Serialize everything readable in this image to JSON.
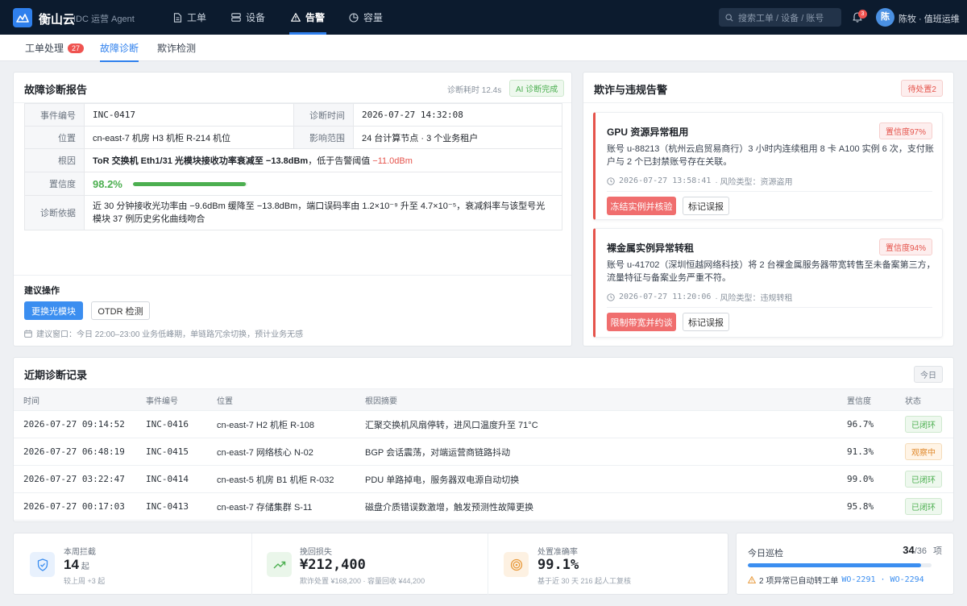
{
  "app": {
    "brand": "衡山云",
    "subtitle": "IDC 运营 Agent"
  },
  "nav": [
    {
      "label": "工单",
      "icon": "document-icon"
    },
    {
      "label": "设备",
      "icon": "server-icon"
    },
    {
      "label": "告警",
      "icon": "warning-icon",
      "active": true
    },
    {
      "label": "容量",
      "icon": "pie-chart-icon"
    }
  ],
  "header": {
    "search_placeholder": "搜索工单 / 设备 / 账号",
    "notifications": "3",
    "avatar_initial": "陈",
    "user": "陈牧 · 值班运维"
  },
  "subtabs": [
    {
      "label": "工单处理",
      "count": "27"
    },
    {
      "label": "故障诊断",
      "active": true
    },
    {
      "label": "欺诈检测"
    }
  ],
  "diagnosis": {
    "title": "故障诊断报告",
    "elapsed": "诊断耗时 12.4s",
    "status": "AI 诊断完成",
    "fields": {
      "incident_k": "事件编号",
      "incident_v": "INC-0417",
      "time_k": "诊断时间",
      "time_v": "2026-07-27 14:32:08",
      "location_k": "位置",
      "location_v": "cn-east-7 机房 H3 机柜 R-214 机位",
      "scope_k": "影响范围",
      "scope_v": "24 台计算节点 · 3 个业务租户",
      "cause_k": "根因",
      "cause_main": "ToR 交换机 Eth1/31 光模块接收功率衰减至 −13.8dBm",
      "cause_mid": "，低于告警阈值 ",
      "cause_threshold": "−11.0dBm",
      "confidence_k": "置信度",
      "confidence_v": "98.2%",
      "basis_k": "诊断依据",
      "basis_v": "近 30 分钟接收光功率由 −9.6dBm 缓降至 −13.8dBm，端口误码率由 1.2×10⁻⁹ 升至 4.7×10⁻⁵，衰减斜率与该型号光模块 37 例历史劣化曲线吻合"
    },
    "confidence": 0.982,
    "suggest_title": "建议操作",
    "btn_replace": "更换光模块",
    "btn_otdr": "OTDR 检测",
    "window_note": "建议窗口：今日 22:00–23:00 业务低峰期，单链路冗余切换，预计业务无感"
  },
  "fraud": {
    "title": "欺诈与违规告警",
    "pending": "待处置2",
    "cards": [
      {
        "title": "GPU 资源异常租用",
        "confidence": "置信度97%",
        "desc": "账号 u-88213（杭州云启贸易商行）3 小时内连续租用 8 卡 A100 实例 6 次，支付账户与 2 个已封禁账号存在关联。",
        "time": "2026-07-27 13:58:41",
        "risk": "· 风险类型：资源盗用",
        "action": "冻结实例并核验",
        "dismiss": "标记误报"
      },
      {
        "title": "裸金属实例异常转租",
        "confidence": "置信度94%",
        "desc": "账号 u-41702（深圳恒越网络科技）将 2 台裸金属服务器带宽转售至未备案第三方，流量特征与备案业务严重不符。",
        "time": "2026-07-27 11:20:06",
        "risk": "· 风险类型：违规转租",
        "action": "限制带宽并约谈",
        "dismiss": "标记误报"
      }
    ]
  },
  "history": {
    "title": "近期诊断记录",
    "filter": "今日",
    "columns": [
      "时间",
      "事件编号",
      "位置",
      "根因摘要",
      "置信度",
      "状态"
    ],
    "rows": [
      {
        "time": "2026-07-27 09:14:52",
        "id": "INC-0416",
        "location": "cn-east-7 H2 机柜 R-108",
        "summary": "汇聚交换机风扇停转，进风口温度升至 71°C",
        "conf": "96.7%",
        "status": "已闭环",
        "tone": "green"
      },
      {
        "time": "2026-07-27 06:48:19",
        "id": "INC-0415",
        "location": "cn-east-7 网络核心 N-02",
        "summary": "BGP 会话震荡，对端运营商链路抖动",
        "conf": "91.3%",
        "status": "观察中",
        "tone": "orange"
      },
      {
        "time": "2026-07-27 03:22:47",
        "id": "INC-0414",
        "location": "cn-east-5 机房 B1 机柜 R-032",
        "summary": "PDU 单路掉电，服务器双电源自动切换",
        "conf": "99.0%",
        "status": "已闭环",
        "tone": "green"
      },
      {
        "time": "2026-07-27 00:17:03",
        "id": "INC-0413",
        "location": "cn-east-7 存储集群 S-11",
        "summary": "磁盘介质错误数激增，触发预测性故障更换",
        "conf": "95.8%",
        "status": "已闭环",
        "tone": "green"
      }
    ]
  },
  "stats": [
    {
      "label": "本周拦截",
      "value": "14",
      "unit": "起",
      "sub": "较上周 +3 起",
      "icon": "shield-icon",
      "color": "#3b8ef0",
      "bg": "#e8f1fd"
    },
    {
      "label": "挽回损失",
      "value": "¥212,400",
      "unit": "",
      "sub": "欺诈处置 ¥168,200 · 容量回收 ¥44,200",
      "icon": "trend-up-icon",
      "color": "#4caf50",
      "bg": "#eaf6ea"
    },
    {
      "label": "处置准确率",
      "value": "99.1%",
      "unit": "",
      "sub": "基于近 30 天 216 起人工复核",
      "icon": "target-icon",
      "color": "#e89a3c",
      "bg": "#fdf1e2"
    }
  ],
  "patrol": {
    "label": "今日巡检",
    "done": "34",
    "total": "/36",
    "unit": "项",
    "progress": 0.944,
    "note": "2 项异常已自动转工单",
    "tickets": "WO-2291 · WO-2294"
  }
}
